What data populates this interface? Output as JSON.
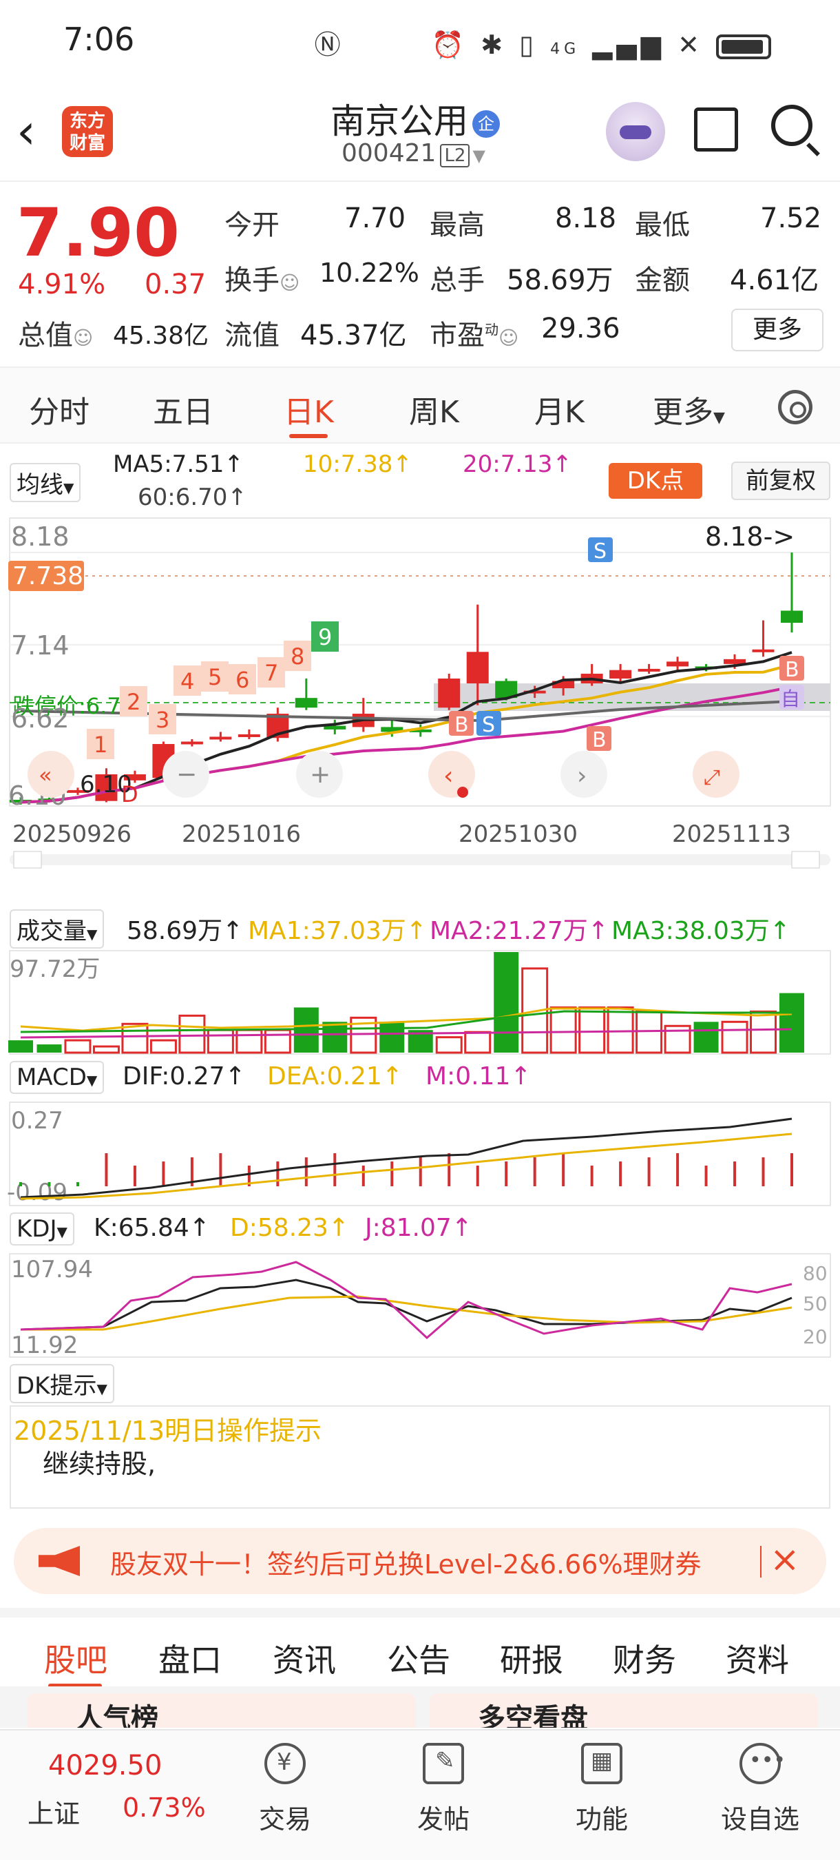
{
  "status": {
    "time": "7:06",
    "network": "4G"
  },
  "header": {
    "logo_line1": "东方",
    "logo_line2": "财富",
    "name": "南京公用",
    "badge": "企",
    "code": "000421",
    "level": "L2"
  },
  "quote": {
    "price": "7.90",
    "pct": "4.91%",
    "change": "0.37",
    "open_label": "今开",
    "open": "7.70",
    "high_label": "最高",
    "high": "8.18",
    "low_label": "最低",
    "low": "7.52",
    "turnover_label": "换手",
    "turnover": "10.22%",
    "volume_label": "总手",
    "volume": "58.69万",
    "amount_label": "金额",
    "amount": "4.61亿",
    "mcap_label": "总值",
    "mcap": "45.38亿",
    "float_label": "流值",
    "float": "45.37亿",
    "pe_label": "市盈",
    "pe_sup": "动",
    "pe": "29.36",
    "more": "更多"
  },
  "period_tabs": [
    "分时",
    "五日",
    "日K",
    "周K",
    "月K",
    "更多"
  ],
  "active_period": "日K",
  "ma_row": {
    "selector": "均线",
    "ma5": "MA5:7.51↑",
    "ma10": "10:7.38↑",
    "ma20": "20:7.13↑",
    "ma60": "60:6.70↑",
    "dk": "DK点",
    "fq": "前复权"
  },
  "kline": {
    "price_labels": [
      "8.18",
      "7.14",
      "6.62",
      "6.10"
    ],
    "current_tag": "7.738",
    "limit_label": "跌停价:6.78",
    "high_callout": "8.18->",
    "low_callout": "6.10",
    "dates": [
      "20250926",
      "20251016",
      "20251030",
      "20251113"
    ],
    "tag_nums": [
      "1",
      "2",
      "3",
      "4",
      "5",
      "6",
      "7",
      "8",
      "9"
    ],
    "mark_b": "B",
    "mark_s": "S",
    "mark_d": "D",
    "mark_zi": "自"
  },
  "chart_data": {
    "type": "candlestick",
    "ylim": [
      6.1,
      8.18
    ],
    "candles": [
      {
        "o": 6.14,
        "c": 6.12,
        "h": 6.16,
        "l": 6.1
      },
      {
        "o": 6.15,
        "c": 6.14,
        "h": 6.16,
        "l": 6.12
      },
      {
        "o": 6.2,
        "c": 6.22,
        "h": 6.24,
        "l": 6.18
      },
      {
        "o": 6.13,
        "c": 6.35,
        "h": 6.4,
        "l": 6.12
      },
      {
        "o": 6.3,
        "c": 6.35,
        "h": 6.38,
        "l": 6.28
      },
      {
        "o": 6.32,
        "c": 6.6,
        "h": 6.62,
        "l": 6.3
      },
      {
        "o": 6.6,
        "c": 6.62,
        "h": 6.64,
        "l": 6.58
      },
      {
        "o": 6.66,
        "c": 6.66,
        "h": 6.7,
        "l": 6.62
      },
      {
        "o": 6.68,
        "c": 6.68,
        "h": 6.72,
        "l": 6.64
      },
      {
        "o": 6.65,
        "c": 6.85,
        "h": 6.9,
        "l": 6.62
      },
      {
        "o": 6.98,
        "c": 6.9,
        "h": 7.14,
        "l": 6.88
      },
      {
        "o": 6.75,
        "c": 6.72,
        "h": 6.8,
        "l": 6.68
      },
      {
        "o": 6.74,
        "c": 6.85,
        "h": 6.98,
        "l": 6.7
      },
      {
        "o": 6.74,
        "c": 6.7,
        "h": 6.8,
        "l": 6.66
      },
      {
        "o": 6.72,
        "c": 6.7,
        "h": 6.76,
        "l": 6.66
      },
      {
        "o": 6.9,
        "c": 7.14,
        "h": 7.18,
        "l": 6.88
      },
      {
        "o": 7.1,
        "c": 7.36,
        "h": 7.75,
        "l": 6.92
      },
      {
        "o": 7.12,
        "c": 6.98,
        "h": 7.14,
        "l": 6.96
      },
      {
        "o": 7.02,
        "c": 7.04,
        "h": 7.08,
        "l": 6.98
      },
      {
        "o": 7.06,
        "c": 7.12,
        "h": 7.16,
        "l": 7.0
      },
      {
        "o": 7.1,
        "c": 7.18,
        "h": 7.26,
        "l": 7.08
      },
      {
        "o": 7.14,
        "c": 7.21,
        "h": 7.26,
        "l": 7.1
      },
      {
        "o": 7.2,
        "c": 7.22,
        "h": 7.26,
        "l": 7.18
      },
      {
        "o": 7.24,
        "c": 7.28,
        "h": 7.32,
        "l": 7.2
      },
      {
        "o": 7.24,
        "c": 7.22,
        "h": 7.26,
        "l": 7.2
      },
      {
        "o": 7.26,
        "c": 7.3,
        "h": 7.34,
        "l": 7.22
      },
      {
        "o": 7.36,
        "c": 7.38,
        "h": 7.62,
        "l": 7.32
      },
      {
        "o": 7.7,
        "c": 7.6,
        "h": 8.18,
        "l": 7.52
      }
    ],
    "volume_label": "成交量",
    "volume_max": "97.72万",
    "volume_stats": {
      "vol": "58.69万↑",
      "ma1": "MA1:37.03万↑",
      "ma2": "MA2:21.27万↑",
      "ma3": "MA3:38.03万↑"
    },
    "volumes": [
      12,
      8,
      12,
      6,
      28,
      12,
      36,
      22,
      22,
      22,
      44,
      30,
      34,
      30,
      22,
      15,
      20,
      98,
      82,
      44,
      44,
      44,
      40,
      26,
      30,
      30,
      40,
      58
    ],
    "macd_label": "MACD",
    "macd_stats": {
      "dif": "DIF:0.27↑",
      "dea": "DEA:0.21↑",
      "m": "M:0.11↑"
    },
    "macd_axis": [
      "0.27",
      "-0.09"
    ],
    "kdj_label": "KDJ",
    "kdj_stats": {
      "k": "K:65.84↑",
      "d": "D:58.23↑",
      "j": "J:81.07↑"
    },
    "kdj_axis": [
      "107.94",
      "11.92"
    ],
    "kdj_right": [
      "80",
      "50",
      "20"
    ]
  },
  "dk_panel": {
    "selector": "DK提示",
    "date_line": "2025/11/13明日操作提示",
    "advice": "继续持股,"
  },
  "promo": {
    "text": "股友双十一！签约后可兑换Level-2&6.66%理财券"
  },
  "content_tabs": [
    "股吧",
    "盘口",
    "资讯",
    "公告",
    "研报",
    "财务",
    "资料"
  ],
  "peek": {
    "left": "人气榜",
    "right": "多空看盘"
  },
  "bottom_nav": {
    "index_value": "4029.50",
    "index_name": "上证",
    "index_pct": "0.73%",
    "items": [
      "交易",
      "发帖",
      "功能",
      "设自选"
    ]
  }
}
